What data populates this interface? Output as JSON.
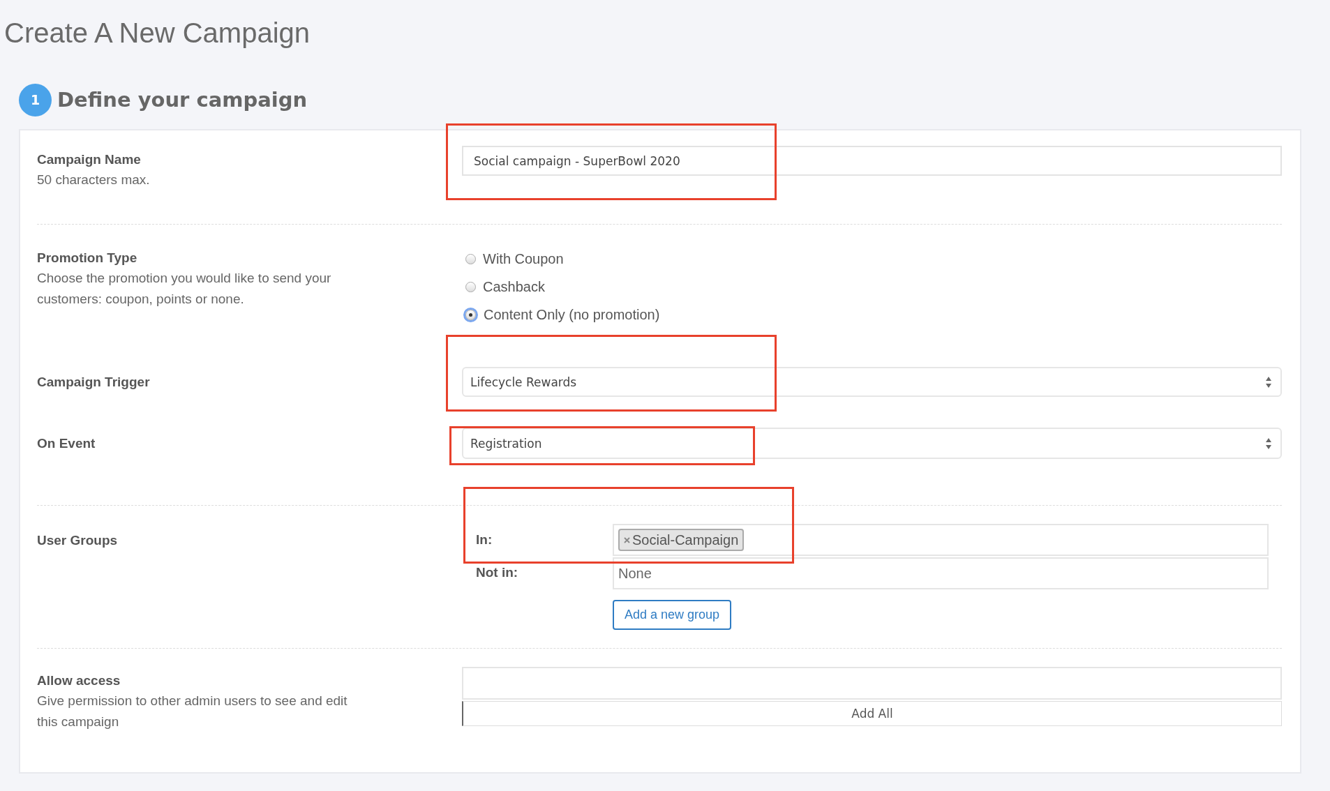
{
  "page_title": "Create A New Campaign",
  "step": {
    "number": "1",
    "title": "Define your campaign"
  },
  "sections": [
    {
      "fields": [
        {
          "kind": "text",
          "label": "Campaign Name",
          "hint": "50 characters max.",
          "value": "Social campaign - SuperBowl 2020",
          "annotated": true
        }
      ]
    },
    {
      "fields": [
        {
          "kind": "radio",
          "label": "Promotion Type",
          "hint": "Choose the promotion you would like to send your customers: coupon, points or none.",
          "options": [
            {
              "label": "With Coupon",
              "selected": false
            },
            {
              "label": "Cashback",
              "selected": false
            },
            {
              "label": "Content Only (no promotion)",
              "selected": true
            }
          ]
        },
        {
          "kind": "select",
          "label": "Campaign Trigger",
          "value": "Lifecycle Rewards",
          "annotated": true
        },
        {
          "kind": "select",
          "label": "On Event",
          "value": "Registration",
          "annotated": true
        }
      ]
    },
    {
      "fields": [
        {
          "kind": "groups",
          "label": "User Groups",
          "in_label": "In:",
          "tags": [
            {
              "label": "Social-Campaign"
            }
          ],
          "not_in_label": "Not in:",
          "not_in_value": "None",
          "button": "Add a new group",
          "annotated": true
        }
      ]
    },
    {
      "fields": [
        {
          "kind": "access",
          "label": "Allow access",
          "hint": "Give permission to other admin users to see and edit this campaign",
          "button": "Add All"
        }
      ]
    }
  ]
}
